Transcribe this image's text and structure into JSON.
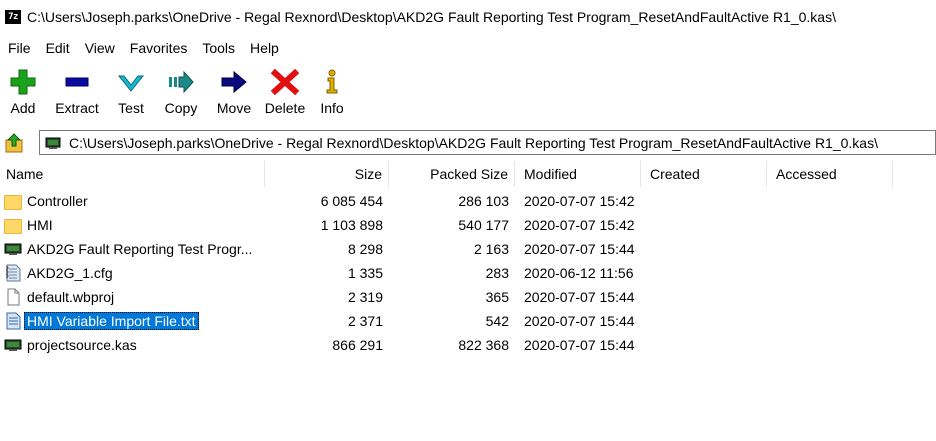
{
  "window": {
    "app_icon_text": "7z",
    "title": "C:\\Users\\Joseph.parks\\OneDrive - Regal Rexnord\\Desktop\\AKD2G Fault Reporting Test Program_ResetAndFaultActive R1_0.kas\\"
  },
  "menu": [
    "File",
    "Edit",
    "View",
    "Favorites",
    "Tools",
    "Help"
  ],
  "toolbar": [
    {
      "label": "Add",
      "icon": "plus-icon",
      "color": "#1aa31a"
    },
    {
      "label": "Extract",
      "icon": "minus-icon",
      "color": "#0a0aa0"
    },
    {
      "label": "Test",
      "icon": "check-icon",
      "color": "#18b8d0"
    },
    {
      "label": "Copy",
      "icon": "copy-arrow-icon",
      "color": "#1a8a8a"
    },
    {
      "label": "Move",
      "icon": "move-arrow-icon",
      "color": "#0a0a80"
    },
    {
      "label": "Delete",
      "icon": "delete-x-icon",
      "color": "#e01010"
    },
    {
      "label": "Info",
      "icon": "info-icon",
      "color": "#c8a000"
    }
  ],
  "address": {
    "path": "C:\\Users\\Joseph.parks\\OneDrive - Regal Rexnord\\Desktop\\AKD2G Fault Reporting Test Program_ResetAndFaultActive R1_0.kas\\"
  },
  "columns": {
    "name": "Name",
    "size": "Size",
    "packed": "Packed Size",
    "modified": "Modified",
    "created": "Created",
    "accessed": "Accessed"
  },
  "files": [
    {
      "name": "Controller",
      "icon": "folder-icon",
      "size": "6 085 454",
      "packed": "286 103",
      "modified": "2020-07-07 15:42",
      "selected": false
    },
    {
      "name": "HMI",
      "icon": "folder-icon",
      "size": "1 103 898",
      "packed": "540 177",
      "modified": "2020-07-07 15:42",
      "selected": false
    },
    {
      "name": "AKD2G Fault Reporting Test Progr...",
      "icon": "kas-file-icon",
      "size": "8 298",
      "packed": "2 163",
      "modified": "2020-07-07 15:44",
      "selected": false
    },
    {
      "name": "AKD2G_1.cfg",
      "icon": "cfg-file-icon",
      "size": "1 335",
      "packed": "283",
      "modified": "2020-06-12 11:56",
      "selected": false
    },
    {
      "name": "default.wbproj",
      "icon": "blank-file-icon",
      "size": "2 319",
      "packed": "365",
      "modified": "2020-07-07 15:44",
      "selected": false
    },
    {
      "name": "HMI Variable Import File.txt",
      "icon": "text-file-icon",
      "size": "2 371",
      "packed": "542",
      "modified": "2020-07-07 15:44",
      "selected": true
    },
    {
      "name": "projectsource.kas",
      "icon": "kas-file-icon",
      "size": "866 291",
      "packed": "822 368",
      "modified": "2020-07-07 15:44",
      "selected": false
    }
  ]
}
